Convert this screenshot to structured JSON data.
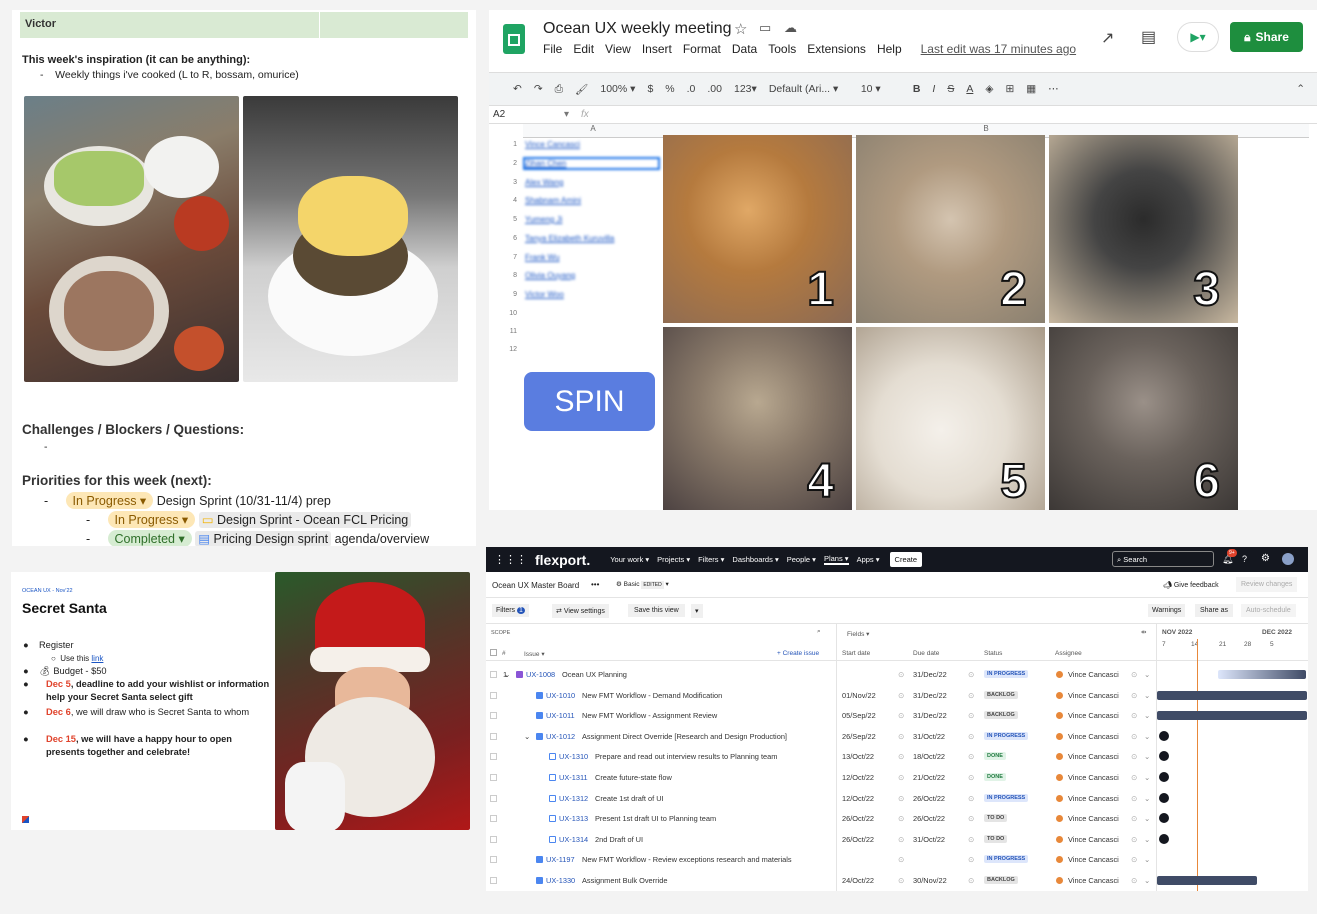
{
  "doc": {
    "name": "Victor",
    "inspiration_heading": "This week's inspiration (it can be anything):",
    "inspiration_item": "Weekly things i've cooked (L to R, bossam, omurice)",
    "challenges_heading": "Challenges / Blockers / Questions:",
    "challenges_item": "-",
    "priorities_heading": "Priorities for this week (next):",
    "priorities": [
      {
        "status": "In Progress",
        "text": "Design Sprint (10/31-11/4) prep",
        "ref": ""
      },
      {
        "status": "In Progress",
        "text": "",
        "ref": "Design Sprint - Ocean FCL Pricing"
      },
      {
        "status": "Completed",
        "text": "agenda/overview",
        "ref": "Pricing Design sprint"
      }
    ]
  },
  "sheet": {
    "title": "Ocean UX weekly meeting",
    "menu": [
      "File",
      "Edit",
      "View",
      "Insert",
      "Format",
      "Data",
      "Tools",
      "Extensions",
      "Help"
    ],
    "last_edit": "Last edit was 17 minutes ago",
    "share_label": "Share",
    "zoom": "100%",
    "currency": "$",
    "percent": "%",
    "dec_less": ".0",
    "dec_more": ".00",
    "format_123": "123",
    "font": "Default (Ari...",
    "font_size": "10",
    "cell_ref": "A2",
    "fx": "fx",
    "col_a": "A",
    "col_b": "B",
    "names": [
      "Vince Cancasci",
      "Zihan Chen",
      "Alex Wang",
      "Shabnam Amini",
      "Yumeng Ji",
      "Tanya Elizabeth Kuruvilla",
      "Frank Wu",
      "Olivia Ouyang",
      "Victor Woo"
    ],
    "row_numbers": [
      "1",
      "2",
      "3",
      "4",
      "5",
      "6",
      "7",
      "8",
      "9",
      "10",
      "11",
      "12"
    ],
    "spin_label": "SPIN",
    "cat_numbers": [
      "1",
      "2",
      "3",
      "4",
      "5",
      "6"
    ]
  },
  "santa": {
    "kicker": "OCEAN UX - Nov'22",
    "title": "Secret Santa",
    "register": "Register",
    "use_this": "Use this ",
    "link": "link",
    "budget": "Budget - $50",
    "dec5_date": "Dec 5",
    "dec5_text": ", deadline to add your wishlist or information help your Secret Santa select gift",
    "dec6_date": "Dec 6",
    "dec6_text": ", we will draw who is Secret Santa to whom",
    "dec15_date": "Dec 15",
    "dec15_text": ", we will have a happy hour to open presents together and celebrate!"
  },
  "flex": {
    "logo": "flexport.",
    "nav": [
      "Your work",
      "Projects",
      "Filters",
      "Dashboards",
      "People",
      "Plans",
      "Apps"
    ],
    "create": "Create",
    "search": "Search",
    "notif_count": "9+",
    "board": "Ocean UX Master Board",
    "basic": "Basic",
    "edited": "EDITED",
    "give_feedback": "Give feedback",
    "review_changes": "Review changes",
    "filters": "Filters",
    "filter_count": "1",
    "view_settings": "View settings",
    "save_view": "Save this view",
    "warnings": "Warnings",
    "share_as": "Share as",
    "auto_schedule": "Auto-schedule",
    "scope": "SCOPE",
    "fields": "Fields",
    "col_hash": "#",
    "col_issue": "Issue",
    "create_issue": "Create issue",
    "col_start": "Start date",
    "col_due": "Due date",
    "col_status": "Status",
    "col_assignee": "Assignee",
    "months": [
      "NOV 2022",
      "DEC 2022"
    ],
    "days": [
      "7",
      "14",
      "21",
      "28",
      "5"
    ],
    "rows": [
      {
        "num": "1",
        "key": "UX-1008",
        "title": "Ocean UX Planning",
        "start": "",
        "due": "31/Dec/22",
        "status": "IN PROGRESS",
        "cls": "s-prog",
        "assignee": "Vince Cancasci",
        "indent": 0
      },
      {
        "num": "",
        "key": "UX-1010",
        "title": "New FMT Workflow - Demand Modification",
        "start": "01/Nov/22",
        "due": "31/Dec/22",
        "status": "BACKLOG",
        "cls": "s-back",
        "assignee": "Vince Cancasci",
        "indent": 1
      },
      {
        "num": "",
        "key": "UX-1011",
        "title": "New FMT Workflow - Assignment Review",
        "start": "05/Sep/22",
        "due": "31/Dec/22",
        "status": "BACKLOG",
        "cls": "s-back",
        "assignee": "Vince Cancasci",
        "indent": 1
      },
      {
        "num": "",
        "key": "UX-1012",
        "title": "Assignment Direct Override [Research and Design Production]",
        "start": "26/Sep/22",
        "due": "31/Oct/22",
        "status": "IN PROGRESS",
        "cls": "s-prog",
        "assignee": "Vince Cancasci",
        "indent": 1
      },
      {
        "num": "",
        "key": "UX-1310",
        "title": "Prepare and read out interview results to Planning team",
        "start": "13/Oct/22",
        "due": "18/Oct/22",
        "status": "DONE",
        "cls": "s-done",
        "assignee": "Vince Cancasci",
        "indent": 2
      },
      {
        "num": "",
        "key": "UX-1311",
        "title": "Create future-state flow",
        "start": "12/Oct/22",
        "due": "21/Oct/22",
        "status": "DONE",
        "cls": "s-done",
        "assignee": "Vince Cancasci",
        "indent": 2
      },
      {
        "num": "",
        "key": "UX-1312",
        "title": "Create 1st draft of UI",
        "start": "12/Oct/22",
        "due": "26/Oct/22",
        "status": "IN PROGRESS",
        "cls": "s-prog",
        "assignee": "Vince Cancasci",
        "indent": 2
      },
      {
        "num": "",
        "key": "UX-1313",
        "title": "Present 1st draft UI to Planning team",
        "start": "26/Oct/22",
        "due": "26/Oct/22",
        "status": "TO DO",
        "cls": "s-todo",
        "assignee": "Vince Cancasci",
        "indent": 2
      },
      {
        "num": "",
        "key": "UX-1314",
        "title": "2nd Draft of UI",
        "start": "26/Oct/22",
        "due": "31/Oct/22",
        "status": "TO DO",
        "cls": "s-todo",
        "assignee": "Vince Cancasci",
        "indent": 2
      },
      {
        "num": "",
        "key": "UX-1197",
        "title": "New FMT Workflow - Review exceptions research and materials",
        "start": "",
        "due": "",
        "status": "IN PROGRESS",
        "cls": "s-prog",
        "assignee": "Vince Cancasci",
        "indent": 1
      },
      {
        "num": "",
        "key": "UX-1330",
        "title": "Assignment Bulk Override",
        "start": "24/Oct/22",
        "due": "30/Nov/22",
        "status": "BACKLOG",
        "cls": "s-back",
        "assignee": "Vince Cancasci",
        "indent": 1
      }
    ]
  }
}
